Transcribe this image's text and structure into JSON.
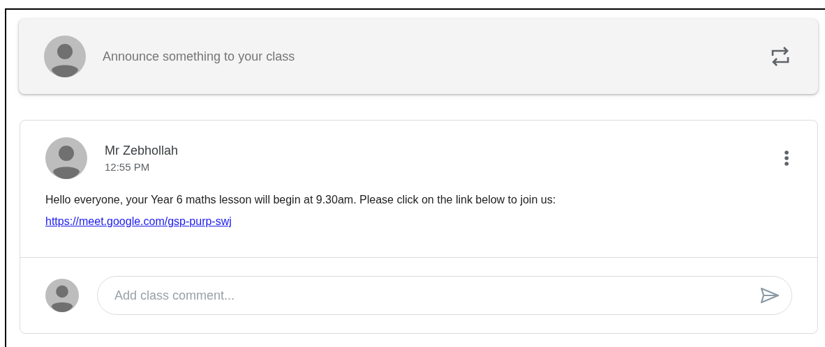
{
  "composer": {
    "placeholder": "Announce something to your class"
  },
  "post": {
    "author": "Mr Zebhollah",
    "time": "12:55 PM",
    "text": "Hello everyone, your Year 6 maths lesson will begin at 9.30am. Please click on the link below to join us:",
    "link": "https://meet.google.com/gsp-purp-swj"
  },
  "comment": {
    "placeholder": "Add class comment..."
  }
}
